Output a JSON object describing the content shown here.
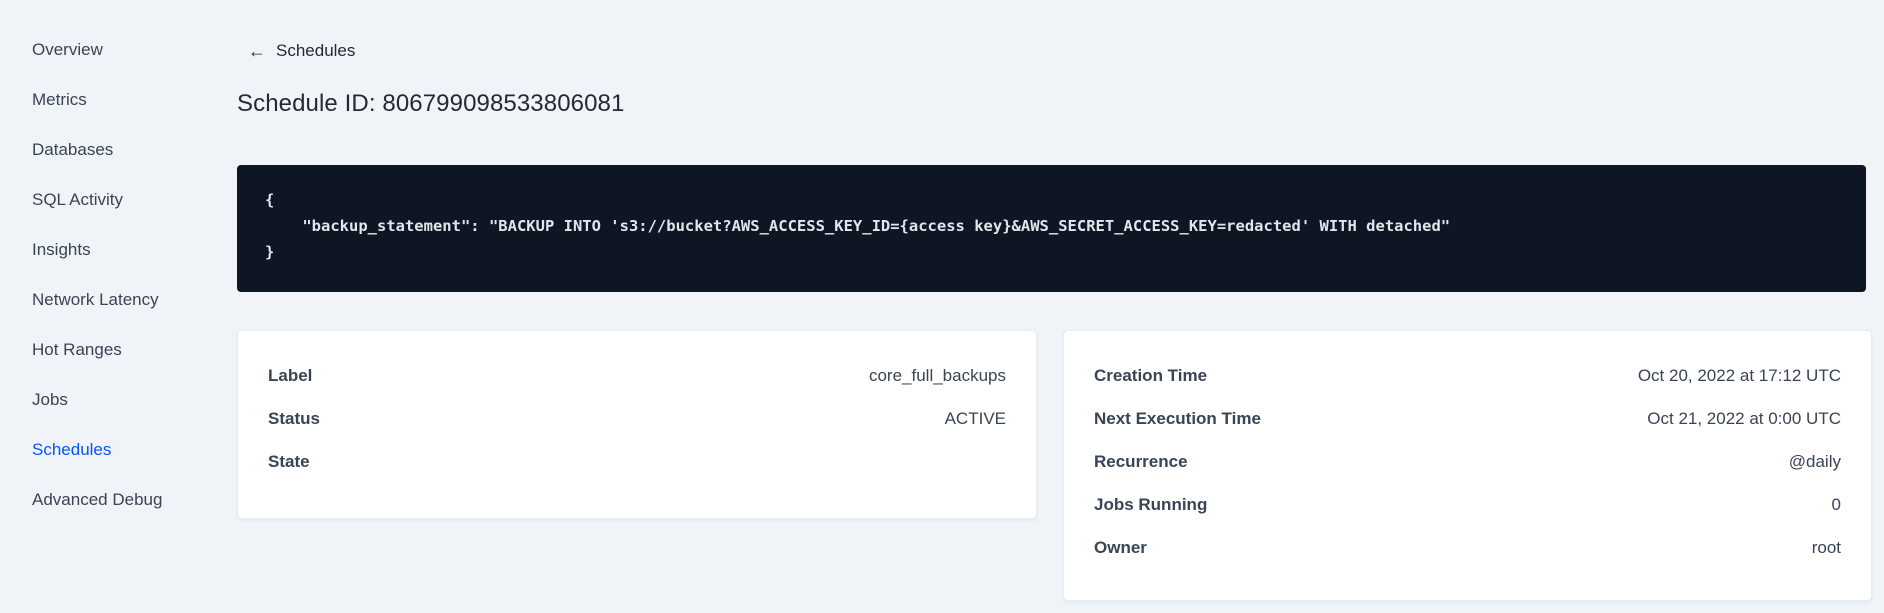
{
  "colors": {
    "page_bg": "#f0f4f8",
    "link_active": "#0055ff",
    "text_primary": "#394455",
    "text_dark": "#242a35",
    "code_bg": "#0e1523",
    "code_text": "#e2e6ec",
    "card_bg": "#ffffff"
  },
  "sidebar": {
    "items": [
      {
        "label": "Overview"
      },
      {
        "label": "Metrics"
      },
      {
        "label": "Databases"
      },
      {
        "label": "SQL Activity"
      },
      {
        "label": "Insights"
      },
      {
        "label": "Network Latency"
      },
      {
        "label": "Hot Ranges"
      },
      {
        "label": "Jobs"
      },
      {
        "label": "Schedules",
        "active": true
      },
      {
        "label": "Advanced Debug"
      }
    ]
  },
  "header": {
    "back_icon": "←",
    "back_label": "Schedules",
    "title": "Schedule ID: 806799098533806081"
  },
  "code_block": {
    "lines": [
      "{",
      "    \"backup_statement\": \"BACKUP INTO 's3://bucket?AWS_ACCESS_KEY_ID={access key}&AWS_SECRET_ACCESS_KEY=redacted' WITH detached\"",
      "}"
    ]
  },
  "details_card": {
    "rows": [
      {
        "label": "Label",
        "value": "core_full_backups"
      },
      {
        "label": "Status",
        "value": "ACTIVE"
      },
      {
        "label": "State",
        "value": ""
      }
    ]
  },
  "schedule_card": {
    "rows": [
      {
        "label": "Creation Time",
        "value": "Oct 20, 2022 at 17:12 UTC"
      },
      {
        "label": "Next Execution Time",
        "value": "Oct 21, 2022 at 0:00 UTC"
      },
      {
        "label": "Recurrence",
        "value": "@daily"
      },
      {
        "label": "Jobs Running",
        "value": "0"
      },
      {
        "label": "Owner",
        "value": "root"
      }
    ]
  }
}
